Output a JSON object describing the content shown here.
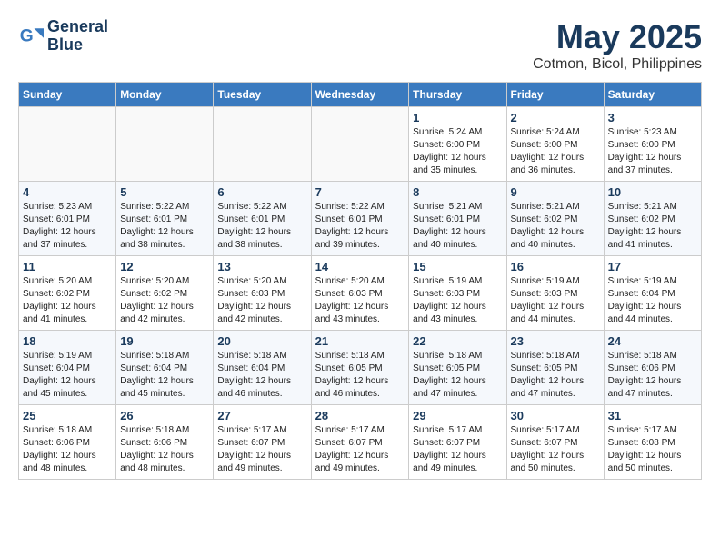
{
  "header": {
    "logo_line1": "General",
    "logo_line2": "Blue",
    "month": "May 2025",
    "location": "Cotmon, Bicol, Philippines"
  },
  "weekdays": [
    "Sunday",
    "Monday",
    "Tuesday",
    "Wednesday",
    "Thursday",
    "Friday",
    "Saturday"
  ],
  "weeks": [
    [
      {
        "day": "",
        "info": ""
      },
      {
        "day": "",
        "info": ""
      },
      {
        "day": "",
        "info": ""
      },
      {
        "day": "",
        "info": ""
      },
      {
        "day": "1",
        "info": "Sunrise: 5:24 AM\nSunset: 6:00 PM\nDaylight: 12 hours\nand 35 minutes."
      },
      {
        "day": "2",
        "info": "Sunrise: 5:24 AM\nSunset: 6:00 PM\nDaylight: 12 hours\nand 36 minutes."
      },
      {
        "day": "3",
        "info": "Sunrise: 5:23 AM\nSunset: 6:00 PM\nDaylight: 12 hours\nand 37 minutes."
      }
    ],
    [
      {
        "day": "4",
        "info": "Sunrise: 5:23 AM\nSunset: 6:01 PM\nDaylight: 12 hours\nand 37 minutes."
      },
      {
        "day": "5",
        "info": "Sunrise: 5:22 AM\nSunset: 6:01 PM\nDaylight: 12 hours\nand 38 minutes."
      },
      {
        "day": "6",
        "info": "Sunrise: 5:22 AM\nSunset: 6:01 PM\nDaylight: 12 hours\nand 38 minutes."
      },
      {
        "day": "7",
        "info": "Sunrise: 5:22 AM\nSunset: 6:01 PM\nDaylight: 12 hours\nand 39 minutes."
      },
      {
        "day": "8",
        "info": "Sunrise: 5:21 AM\nSunset: 6:01 PM\nDaylight: 12 hours\nand 40 minutes."
      },
      {
        "day": "9",
        "info": "Sunrise: 5:21 AM\nSunset: 6:02 PM\nDaylight: 12 hours\nand 40 minutes."
      },
      {
        "day": "10",
        "info": "Sunrise: 5:21 AM\nSunset: 6:02 PM\nDaylight: 12 hours\nand 41 minutes."
      }
    ],
    [
      {
        "day": "11",
        "info": "Sunrise: 5:20 AM\nSunset: 6:02 PM\nDaylight: 12 hours\nand 41 minutes."
      },
      {
        "day": "12",
        "info": "Sunrise: 5:20 AM\nSunset: 6:02 PM\nDaylight: 12 hours\nand 42 minutes."
      },
      {
        "day": "13",
        "info": "Sunrise: 5:20 AM\nSunset: 6:03 PM\nDaylight: 12 hours\nand 42 minutes."
      },
      {
        "day": "14",
        "info": "Sunrise: 5:20 AM\nSunset: 6:03 PM\nDaylight: 12 hours\nand 43 minutes."
      },
      {
        "day": "15",
        "info": "Sunrise: 5:19 AM\nSunset: 6:03 PM\nDaylight: 12 hours\nand 43 minutes."
      },
      {
        "day": "16",
        "info": "Sunrise: 5:19 AM\nSunset: 6:03 PM\nDaylight: 12 hours\nand 44 minutes."
      },
      {
        "day": "17",
        "info": "Sunrise: 5:19 AM\nSunset: 6:04 PM\nDaylight: 12 hours\nand 44 minutes."
      }
    ],
    [
      {
        "day": "18",
        "info": "Sunrise: 5:19 AM\nSunset: 6:04 PM\nDaylight: 12 hours\nand 45 minutes."
      },
      {
        "day": "19",
        "info": "Sunrise: 5:18 AM\nSunset: 6:04 PM\nDaylight: 12 hours\nand 45 minutes."
      },
      {
        "day": "20",
        "info": "Sunrise: 5:18 AM\nSunset: 6:04 PM\nDaylight: 12 hours\nand 46 minutes."
      },
      {
        "day": "21",
        "info": "Sunrise: 5:18 AM\nSunset: 6:05 PM\nDaylight: 12 hours\nand 46 minutes."
      },
      {
        "day": "22",
        "info": "Sunrise: 5:18 AM\nSunset: 6:05 PM\nDaylight: 12 hours\nand 47 minutes."
      },
      {
        "day": "23",
        "info": "Sunrise: 5:18 AM\nSunset: 6:05 PM\nDaylight: 12 hours\nand 47 minutes."
      },
      {
        "day": "24",
        "info": "Sunrise: 5:18 AM\nSunset: 6:06 PM\nDaylight: 12 hours\nand 47 minutes."
      }
    ],
    [
      {
        "day": "25",
        "info": "Sunrise: 5:18 AM\nSunset: 6:06 PM\nDaylight: 12 hours\nand 48 minutes."
      },
      {
        "day": "26",
        "info": "Sunrise: 5:18 AM\nSunset: 6:06 PM\nDaylight: 12 hours\nand 48 minutes."
      },
      {
        "day": "27",
        "info": "Sunrise: 5:17 AM\nSunset: 6:07 PM\nDaylight: 12 hours\nand 49 minutes."
      },
      {
        "day": "28",
        "info": "Sunrise: 5:17 AM\nSunset: 6:07 PM\nDaylight: 12 hours\nand 49 minutes."
      },
      {
        "day": "29",
        "info": "Sunrise: 5:17 AM\nSunset: 6:07 PM\nDaylight: 12 hours\nand 49 minutes."
      },
      {
        "day": "30",
        "info": "Sunrise: 5:17 AM\nSunset: 6:07 PM\nDaylight: 12 hours\nand 50 minutes."
      },
      {
        "day": "31",
        "info": "Sunrise: 5:17 AM\nSunset: 6:08 PM\nDaylight: 12 hours\nand 50 minutes."
      }
    ]
  ]
}
